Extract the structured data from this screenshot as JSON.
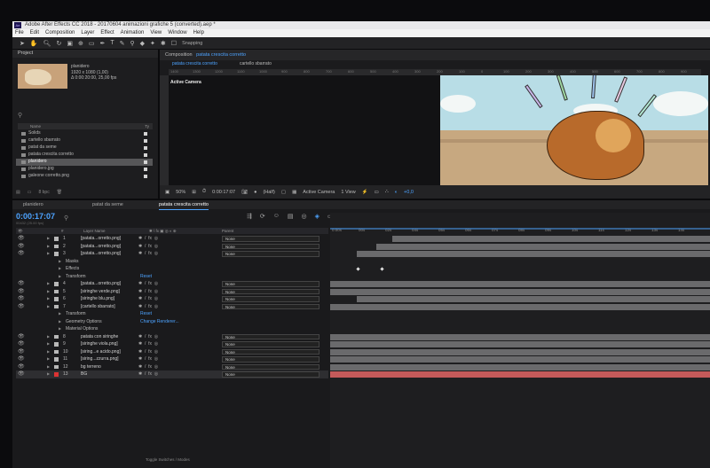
{
  "window": {
    "title": "Adobe After Effects CC 2018 - 20170604 animazioni grafiche 5 (converted).aep *",
    "app_badge": "Ae"
  },
  "menu": [
    "File",
    "Edit",
    "Composition",
    "Layer",
    "Effect",
    "Animation",
    "View",
    "Window",
    "Help"
  ],
  "toolbar": {
    "snapping": "Snapping"
  },
  "project": {
    "title": "Project",
    "selected_name": "planidero",
    "info": [
      "1920 x 1080 (1,00)",
      "Δ 0:00:20:00, 25,00 fps"
    ],
    "col_name": "Name",
    "col_type": "Ty",
    "items": [
      {
        "name": "Solids",
        "selected": false
      },
      {
        "name": "cartello sbarrato",
        "selected": false
      },
      {
        "name": "patat da seme",
        "selected": false
      },
      {
        "name": "patata crescita corretto",
        "selected": false
      },
      {
        "name": "planidero",
        "selected": true
      },
      {
        "name": "planidero.jpg",
        "selected": false
      },
      {
        "name": "galeone corretto.png",
        "selected": false
      }
    ],
    "bpc": "8 bpc"
  },
  "composition": {
    "tab_label": "Composition",
    "tab_name": "patata crescita corretto",
    "sub_tabs": [
      "patata crescita corretto",
      "cartello sbarrato"
    ],
    "active_camera": "Active Camera",
    "ruler_ticks": [
      "1400",
      "1300",
      "1200",
      "1100",
      "1000",
      "900",
      "800",
      "700",
      "600",
      "500",
      "400",
      "300",
      "200",
      "100",
      "0",
      "100",
      "200",
      "300",
      "400",
      "500",
      "600",
      "700",
      "800",
      "900"
    ],
    "zoom": "50%",
    "timecode": "0:00:17:07",
    "resolution": "(Half)",
    "camera": "Active Camera",
    "view": "1 View",
    "exposure": "+0,0"
  },
  "timeline": {
    "tabs": [
      "planidero",
      "patat da seme",
      "patata crescita corretto"
    ],
    "timecode": "0:00:17:07",
    "timecode_sub": "00432 (25.00 fps)",
    "col_layer": "Layer Name",
    "col_parent": "Parent",
    "ruler": [
      "0:00s",
      "00s",
      "02s",
      "04s",
      "05s",
      "06s",
      "07s",
      "08s",
      "09s",
      "10s",
      "11s",
      "12s",
      "13s",
      "14s"
    ],
    "footer": "Toggle Switches / Modes",
    "layers": [
      {
        "num": "1",
        "name": "[patata...orretto.png]",
        "parent": "None",
        "kind": "layer"
      },
      {
        "num": "2",
        "name": "[patata...orretto.png]",
        "parent": "None",
        "kind": "layer"
      },
      {
        "num": "3",
        "name": "[patata...orretto.png]",
        "parent": "None",
        "kind": "layer"
      },
      {
        "name": "Masks",
        "kind": "sub"
      },
      {
        "name": "Effects",
        "kind": "sub"
      },
      {
        "name": "Transform",
        "reset": "Reset",
        "kind": "sub"
      },
      {
        "num": "4",
        "name": "[patata...orretto.png]",
        "parent": "None",
        "kind": "layer"
      },
      {
        "num": "5",
        "name": "[siringhe verde.png]",
        "parent": "None",
        "kind": "layer"
      },
      {
        "num": "6",
        "name": "[siringhe blu.png]",
        "parent": "None",
        "kind": "layer"
      },
      {
        "num": "7",
        "name": "[cartello sbarrato]",
        "parent": "None",
        "kind": "layer"
      },
      {
        "name": "Transform",
        "reset": "Reset",
        "kind": "sub"
      },
      {
        "name": "Geometry Options",
        "reset": "Change Renderer...",
        "kind": "sub"
      },
      {
        "name": "Material Options",
        "kind": "sub"
      },
      {
        "num": "8",
        "name": "patata con siringhe",
        "parent": "None",
        "kind": "layer"
      },
      {
        "num": "9",
        "name": "[siringhe viola.png]",
        "parent": "None",
        "kind": "layer"
      },
      {
        "num": "10",
        "name": "[siring...e acido.png]",
        "parent": "None",
        "kind": "layer"
      },
      {
        "num": "11",
        "name": "[siring...zzurra.png]",
        "parent": "None",
        "kind": "layer"
      },
      {
        "num": "12",
        "name": "bg terreno",
        "parent": "None",
        "kind": "layer"
      },
      {
        "num": "13",
        "name": "BG",
        "parent": "None",
        "kind": "layer",
        "selected": true
      }
    ]
  },
  "colors": {
    "accent": "#4da3ff",
    "bg_layer_bar": "#c45a5a",
    "panel": "#1d1d1f"
  }
}
